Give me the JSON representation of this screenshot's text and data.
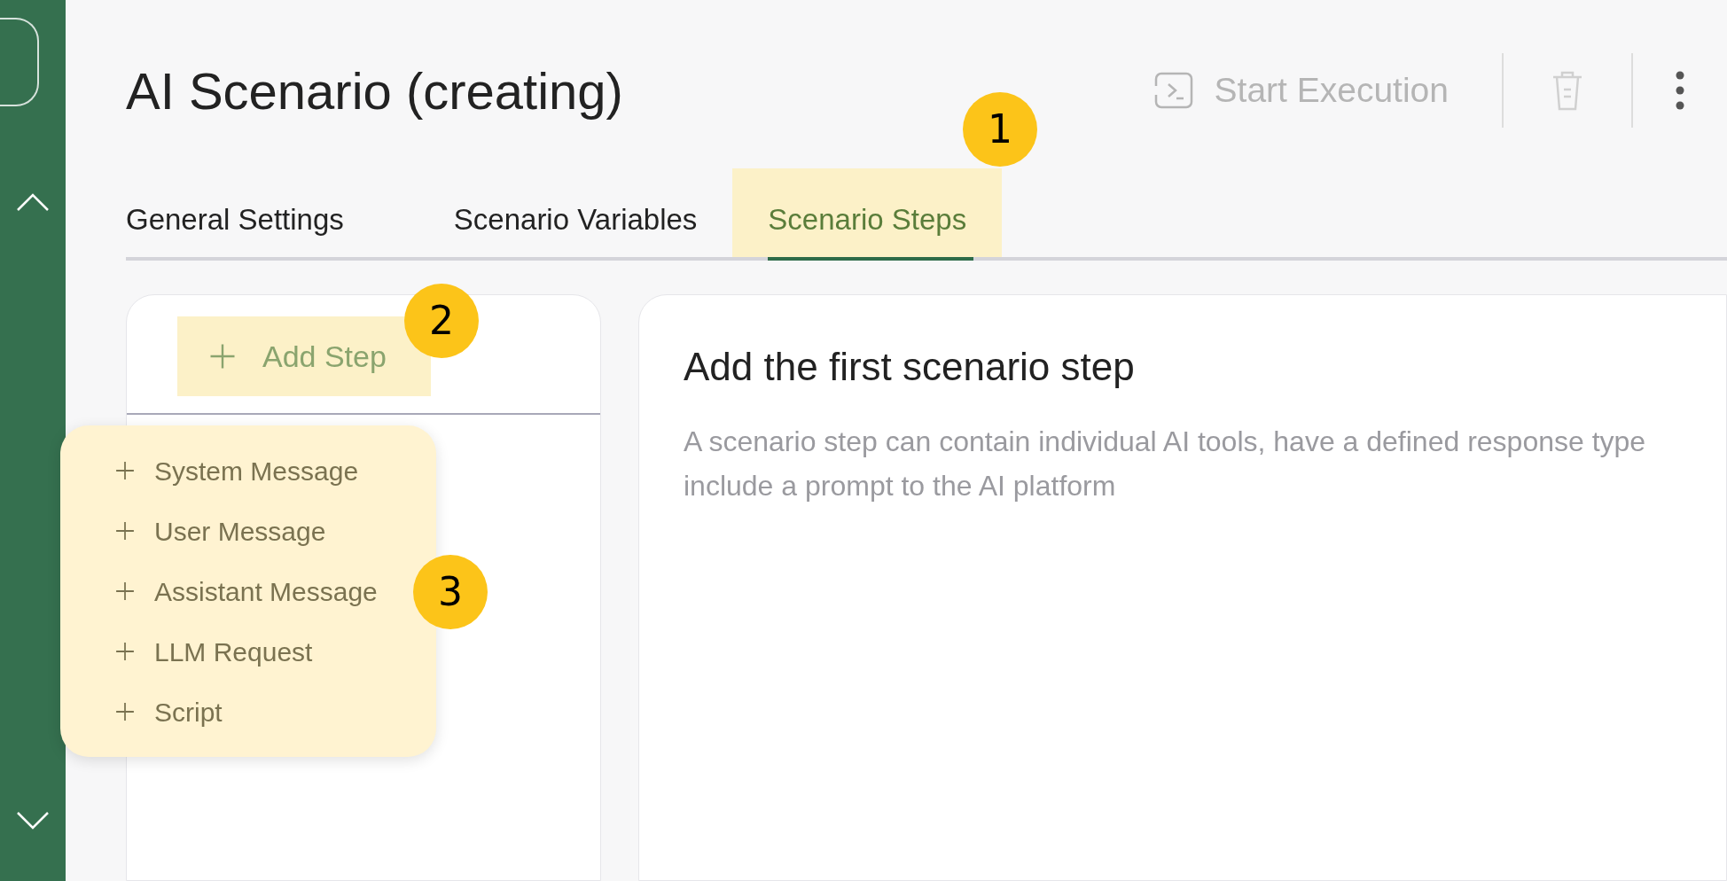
{
  "header": {
    "title": "AI Scenario (creating)",
    "start_execution": {
      "label": "Start Execution",
      "disabled": true
    }
  },
  "tabs": [
    {
      "label": "General Settings",
      "selected": false
    },
    {
      "label": "Scenario Variables",
      "selected": false
    },
    {
      "label": "Scenario Steps",
      "selected": true
    }
  ],
  "steps_panel": {
    "add_step": "Add Step",
    "menu": [
      "System Message",
      "User Message",
      "Assistant Message",
      "LLM Request",
      "Script"
    ]
  },
  "detail": {
    "heading": "Add the first scenario step",
    "description": "A scenario step can contain individual AI tools, have a defined response type include a prompt to the AI platform"
  },
  "callouts": [
    "1",
    "2",
    "3"
  ]
}
